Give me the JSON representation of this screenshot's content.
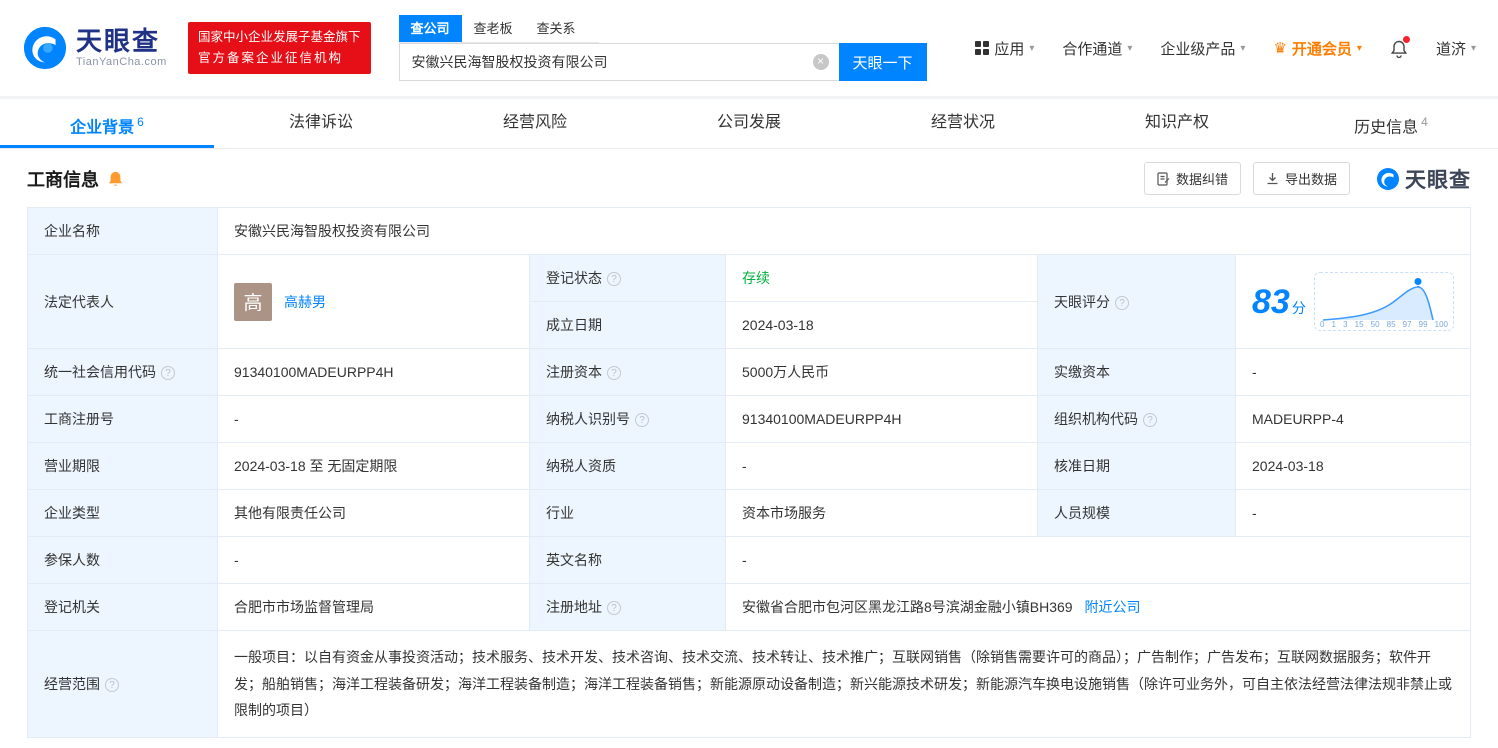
{
  "colors": {
    "brand_blue": "#0084ff",
    "badge_red": "#e60f17",
    "vip_orange": "#ff7d00",
    "status_green": "#00b240",
    "label_bg": "#edf5fe"
  },
  "icons": {
    "help": "?",
    "caret": "▾",
    "clear": "×",
    "crown": "♛"
  },
  "header": {
    "logo": {
      "name": "天眼查",
      "domain": "TianYanCha.com"
    },
    "cert_badge": {
      "line1": "国家中小企业发展子基金旗下",
      "line2": "官方备案企业征信机构"
    },
    "search": {
      "tabs": [
        {
          "label": "查公司"
        },
        {
          "label": "查老板"
        },
        {
          "label": "查关系"
        }
      ],
      "value": "安徽兴民海智股权投资有限公司",
      "button_label": "天眼一下"
    },
    "nav": {
      "apps": "应用",
      "cooperation": "合作通道",
      "enterprise": "企业级产品",
      "vip": "开通会员",
      "user": "道济"
    }
  },
  "tabs": [
    {
      "label": "企业背景",
      "count": "6"
    },
    {
      "label": "法律诉讼",
      "count": ""
    },
    {
      "label": "经营风险",
      "count": ""
    },
    {
      "label": "公司发展",
      "count": ""
    },
    {
      "label": "经营状况",
      "count": ""
    },
    {
      "label": "知识产权",
      "count": ""
    },
    {
      "label": "历史信息",
      "count": "4"
    }
  ],
  "section": {
    "title": "工商信息",
    "correction_button": "数据纠错",
    "export_button": "导出数据",
    "watermark": "天眼查"
  },
  "score_chart": {
    "score": "83",
    "unit": "分",
    "axis_labels": [
      "0",
      "1",
      "3",
      "15",
      "50",
      "85",
      "97",
      "99",
      "100"
    ]
  },
  "fields": {
    "company_name": {
      "label": "企业名称",
      "value": "安徽兴民海智股权投资有限公司"
    },
    "legal_rep": {
      "label": "法定代表人",
      "value": "高赫男",
      "avatar": "高"
    },
    "reg_status": {
      "label": "登记状态",
      "value": "存续"
    },
    "est_date": {
      "label": "成立日期",
      "value": "2024-03-18"
    },
    "score": {
      "label": "天眼评分"
    },
    "unified_code": {
      "label": "统一社会信用代码",
      "value": "91340100MADEURPP4H"
    },
    "reg_capital": {
      "label": "注册资本",
      "value": "5000万人民币"
    },
    "paid_capital": {
      "label": "实缴资本",
      "value": "-"
    },
    "reg_no": {
      "label": "工商注册号",
      "value": "-"
    },
    "taxpayer_id": {
      "label": "纳税人识别号",
      "value": "91340100MADEURPP4H"
    },
    "org_code": {
      "label": "组织机构代码",
      "value": "MADEURPP-4"
    },
    "biz_term": {
      "label": "营业期限",
      "value": "2024-03-18 至 无固定期限"
    },
    "taxpayer_quality": {
      "label": "纳税人资质",
      "value": "-"
    },
    "approval_date": {
      "label": "核准日期",
      "value": "2024-03-18"
    },
    "company_type": {
      "label": "企业类型",
      "value": "其他有限责任公司"
    },
    "industry": {
      "label": "行业",
      "value": "资本市场服务"
    },
    "staff_size": {
      "label": "人员规模",
      "value": "-"
    },
    "insured_num": {
      "label": "参保人数",
      "value": "-"
    },
    "english_name": {
      "label": "英文名称",
      "value": "-"
    },
    "reg_authority": {
      "label": "登记机关",
      "value": "合肥市市场监督管理局"
    },
    "reg_address": {
      "label": "注册地址",
      "value": "安徽省合肥市包河区黑龙江路8号滨湖金融小镇BH369",
      "link": "附近公司"
    },
    "biz_scope": {
      "label": "经营范围",
      "value": "一般项目：以自有资金从事投资活动；技术服务、技术开发、技术咨询、技术交流、技术转让、技术推广；互联网销售（除销售需要许可的商品）；广告制作；广告发布；互联网数据服务；软件开发；船舶销售；海洋工程装备研发；海洋工程装备制造；海洋工程装备销售；新能源原动设备制造；新兴能源技术研发；新能源汽车换电设施销售（除许可业务外，可自主依法经营法律法规非禁止或限制的项目）"
    }
  }
}
